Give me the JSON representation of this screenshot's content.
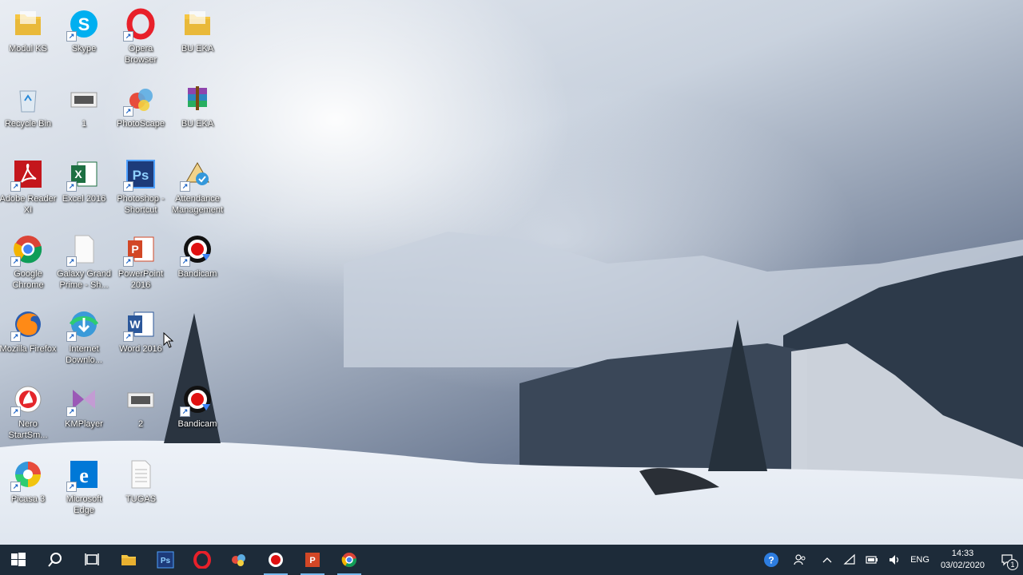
{
  "desktop": {
    "icons": [
      {
        "label": "Modul KS",
        "icon": "folder-icon"
      },
      {
        "label": "Skype",
        "icon": "skype-icon"
      },
      {
        "label": "Opera Browser",
        "icon": "opera-icon"
      },
      {
        "label": "BU EKA",
        "icon": "folder-icon"
      },
      {
        "label": "Recycle Bin",
        "icon": "recycle-bin-icon"
      },
      {
        "label": "1",
        "icon": "image-file-icon"
      },
      {
        "label": "PhotoScape",
        "icon": "photoscape-icon"
      },
      {
        "label": "BU EKA",
        "icon": "winrar-icon"
      },
      {
        "label": "Adobe Reader XI",
        "icon": "adobe-reader-icon"
      },
      {
        "label": "Excel 2016",
        "icon": "excel-icon"
      },
      {
        "label": "Photoshop - Shortcut",
        "icon": "photoshop-icon"
      },
      {
        "label": "Attendance Management",
        "icon": "attendance-icon"
      },
      {
        "label": "Google Chrome",
        "icon": "chrome-icon"
      },
      {
        "label": "Galaxy Grand Prime - Sh...",
        "icon": "blank-file-icon"
      },
      {
        "label": "PowerPoint 2016",
        "icon": "powerpoint-icon"
      },
      {
        "label": "Bandicam",
        "icon": "bandicam-icon"
      },
      {
        "label": "Mozilla Firefox",
        "icon": "firefox-icon"
      },
      {
        "label": "Internet Downlo...",
        "icon": "idm-icon"
      },
      {
        "label": "Word 2016",
        "icon": "word-icon"
      },
      {
        "label": "Nero StartSm...",
        "icon": "nero-icon"
      },
      {
        "label": "KMPlayer",
        "icon": "kmplayer-icon"
      },
      {
        "label": "2",
        "icon": "image-file-icon"
      },
      {
        "label": "Bandicam",
        "icon": "bandicam-icon"
      },
      {
        "label": "Picasa 3",
        "icon": "picasa-icon"
      },
      {
        "label": "Microsoft Edge",
        "icon": "edge-icon"
      },
      {
        "label": "TUGAS",
        "icon": "text-file-icon"
      }
    ]
  },
  "taskbar": {
    "buttons": [
      {
        "name": "start-button",
        "icon": "windows-icon"
      },
      {
        "name": "search-button",
        "icon": "search-icon"
      },
      {
        "name": "task-view-button",
        "icon": "task-view-icon"
      },
      {
        "name": "file-explorer-button",
        "icon": "folder-icon"
      },
      {
        "name": "photoshop-taskbar-button",
        "icon": "photoshop-icon"
      },
      {
        "name": "opera-taskbar-button",
        "icon": "opera-icon"
      },
      {
        "name": "photoscape-taskbar-button",
        "icon": "photoscape-icon"
      },
      {
        "name": "bandicam-taskbar-button",
        "icon": "bandicam-icon"
      },
      {
        "name": "powerpoint-taskbar-button",
        "icon": "powerpoint-icon"
      },
      {
        "name": "chrome-taskbar-button",
        "icon": "chrome-icon"
      }
    ],
    "tray": {
      "language": "ENG",
      "time": "14:33",
      "date": "03/02/2020",
      "notifications_count": "1"
    }
  },
  "colors": {
    "taskbar": "#1d2b39",
    "accent": "#76b9ed"
  }
}
